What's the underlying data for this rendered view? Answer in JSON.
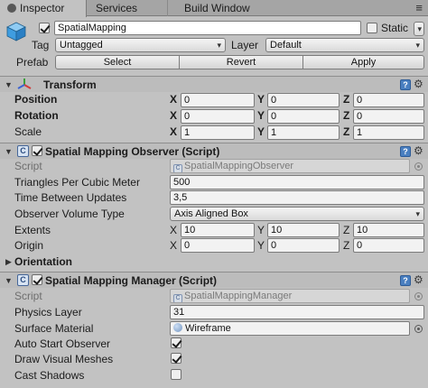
{
  "tabs": {
    "inspector": "Inspector",
    "services": "Services",
    "build_window": "Build Window"
  },
  "header": {
    "object_name": "SpatialMapping",
    "active": true,
    "static_label": "Static",
    "static_checked": false,
    "tag_label": "Tag",
    "tag_value": "Untagged",
    "layer_label": "Layer",
    "layer_value": "Default",
    "prefab_label": "Prefab",
    "select_label": "Select",
    "revert_label": "Revert",
    "apply_label": "Apply"
  },
  "transform": {
    "title": "Transform",
    "position_label": "Position",
    "rotation_label": "Rotation",
    "scale_label": "Scale",
    "position": {
      "x": "0",
      "y": "0",
      "z": "0"
    },
    "rotation": {
      "x": "0",
      "y": "0",
      "z": "0"
    },
    "scale": {
      "x": "1",
      "y": "1",
      "z": "1"
    }
  },
  "axis_labels": {
    "x": "X",
    "y": "Y",
    "z": "Z"
  },
  "observer": {
    "title": "Spatial Mapping Observer (Script)",
    "enabled": true,
    "script_label": "Script",
    "script_value": "SpatialMappingObserver",
    "triangles_label": "Triangles Per Cubic Meter",
    "triangles_value": "500",
    "time_label": "Time Between Updates",
    "time_value": "3,5",
    "volume_type_label": "Observer Volume Type",
    "volume_type_value": "Axis Aligned Box",
    "extents_label": "Extents",
    "extents": {
      "x": "10",
      "y": "10",
      "z": "10"
    },
    "origin_label": "Origin",
    "origin": {
      "x": "0",
      "y": "0",
      "z": "0"
    },
    "orientation_label": "Orientation"
  },
  "manager": {
    "title": "Spatial Mapping Manager (Script)",
    "enabled": true,
    "script_label": "Script",
    "script_value": "SpatialMappingManager",
    "physics_layer_label": "Physics Layer",
    "physics_layer_value": "31",
    "surface_material_label": "Surface Material",
    "surface_material_value": "Wireframe",
    "auto_start_label": "Auto Start Observer",
    "auto_start_checked": true,
    "draw_visual_label": "Draw Visual Meshes",
    "draw_visual_checked": true,
    "cast_shadows_label": "Cast Shadows",
    "cast_shadows_checked": false
  },
  "icons": {
    "gameobject": "cube-icon",
    "transform": "transform-axes-icon",
    "help": "help-book-icon",
    "settings": "gear-icon",
    "script": "script-file-icon",
    "object_picker": "object-picker-icon",
    "tab_menu": "context-menu-icon"
  },
  "colors": {
    "panel_bg": "#c2c2c2",
    "tab_bar": "#a5a5a5",
    "cube_icon": "#3f9de0",
    "material_icon": "#6f93c0"
  }
}
